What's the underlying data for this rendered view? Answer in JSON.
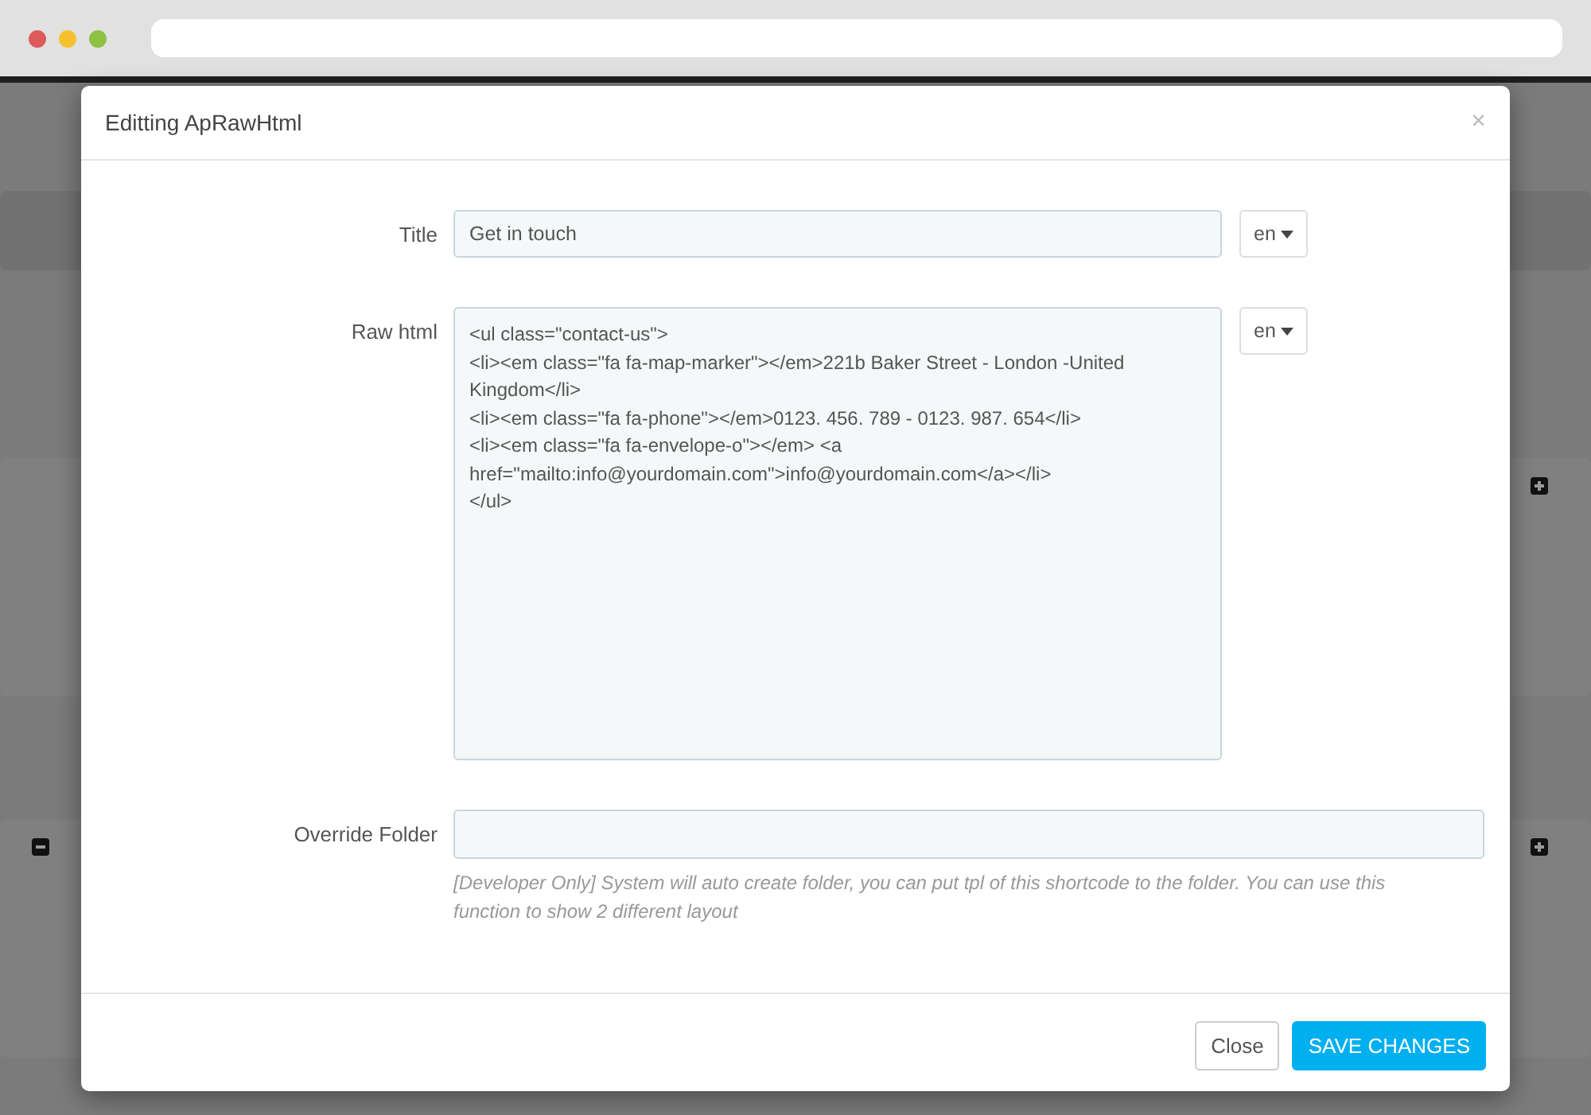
{
  "modal": {
    "title": "Editting ApRawHtml",
    "close_icon": "×"
  },
  "fields": [
    {
      "kind": "input",
      "label": "Title",
      "value": "Get in touch",
      "language": "en"
    },
    {
      "kind": "textarea",
      "label": "Raw html",
      "value": "<ul class=\"contact-us\">\n<li><em class=\"fa fa-map-marker\"></em>221b Baker Street - London -United Kingdom</li>\n<li><em class=\"fa fa-phone\"></em>0123. 456. 789 - 0123. 987. 654</li>\n<li><em class=\"fa fa-envelope-o\"></em> <a href=\"mailto:info@yourdomain.com\">info@yourdomain.com</a></li>\n</ul>",
      "language": "en"
    },
    {
      "kind": "wide",
      "label": "Override Folder",
      "help": "[Developer Only] System will auto create folder, you can put tpl of this shortcode to the folder. You can use this function to show 2 different layout"
    }
  ],
  "buttons": [
    {
      "label": "Close",
      "kind": "default"
    },
    {
      "label": "SAVE CHANGES",
      "kind": "primary"
    }
  ]
}
